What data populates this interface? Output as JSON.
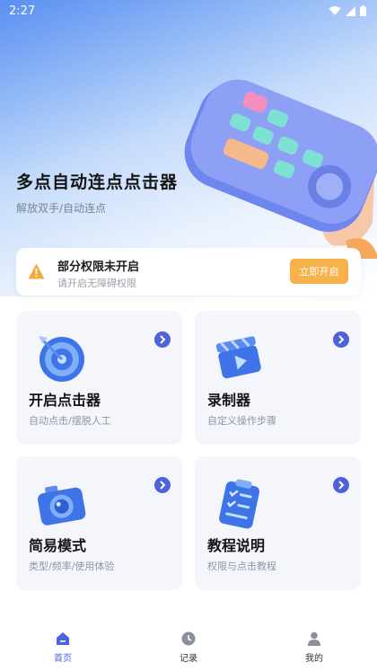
{
  "status_bar": {
    "time": "2:27"
  },
  "hero": {
    "title": "多点自动连点点击器",
    "subtitle": "解放双手/自动连点"
  },
  "notice": {
    "title": "部分权限未开启",
    "subtitle": "请开启无障碍权限",
    "button_label": "立即开启"
  },
  "features": [
    {
      "title": "开启点击器",
      "subtitle": "自动点击/摆脱人工",
      "icon": "target-icon"
    },
    {
      "title": "录制器",
      "subtitle": "自定义操作步骤",
      "icon": "clapperboard-icon"
    },
    {
      "title": "简易模式",
      "subtitle": "类型/频率/使用体验",
      "icon": "camera-icon"
    },
    {
      "title": "教程说明",
      "subtitle": "权限与点击教程",
      "icon": "checklist-icon"
    }
  ],
  "bottom_nav": {
    "items": [
      {
        "label": "首页",
        "icon": "home-icon",
        "active": true
      },
      {
        "label": "记录",
        "icon": "clock-icon",
        "active": false
      },
      {
        "label": "我的",
        "icon": "person-icon",
        "active": false
      }
    ]
  },
  "colors": {
    "accent": "#4f63d9",
    "warning": "#f7b24c",
    "card_bg": "#f5f6fb"
  }
}
